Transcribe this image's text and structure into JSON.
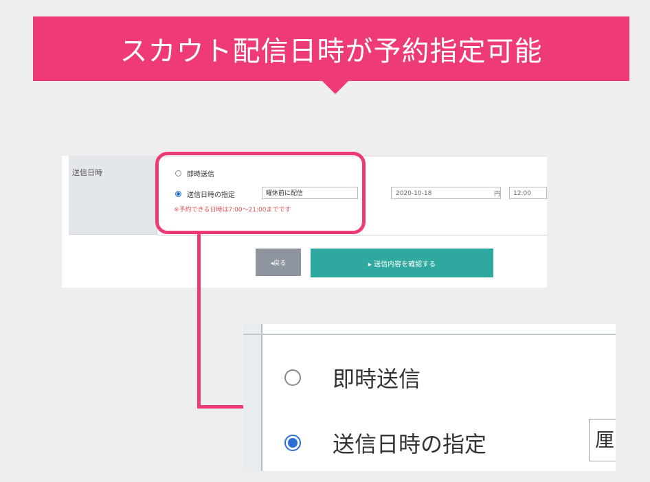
{
  "banner": {
    "title": "スカウト配信日時が予約指定可能"
  },
  "form": {
    "label": "送信日時",
    "option_immediate": "即時送信",
    "option_scheduled": "送信日時の指定",
    "select_value": "曜休前に配信",
    "date_value": "2020-10-18",
    "calendar_glyph": "円",
    "time_value": "12:00",
    "note": "※予約できる日時は7:00〜21:00までです",
    "back_button": "◂戻る",
    "confirm_button": "▸ 送信内容を確認する"
  },
  "zoom": {
    "option_immediate": "即時送信",
    "option_scheduled": "送信日時の指定",
    "select_partial": "厘"
  },
  "colors": {
    "accent": "#ee3b76",
    "teal": "#2fa9a0",
    "radio": "#2a6fd6"
  }
}
